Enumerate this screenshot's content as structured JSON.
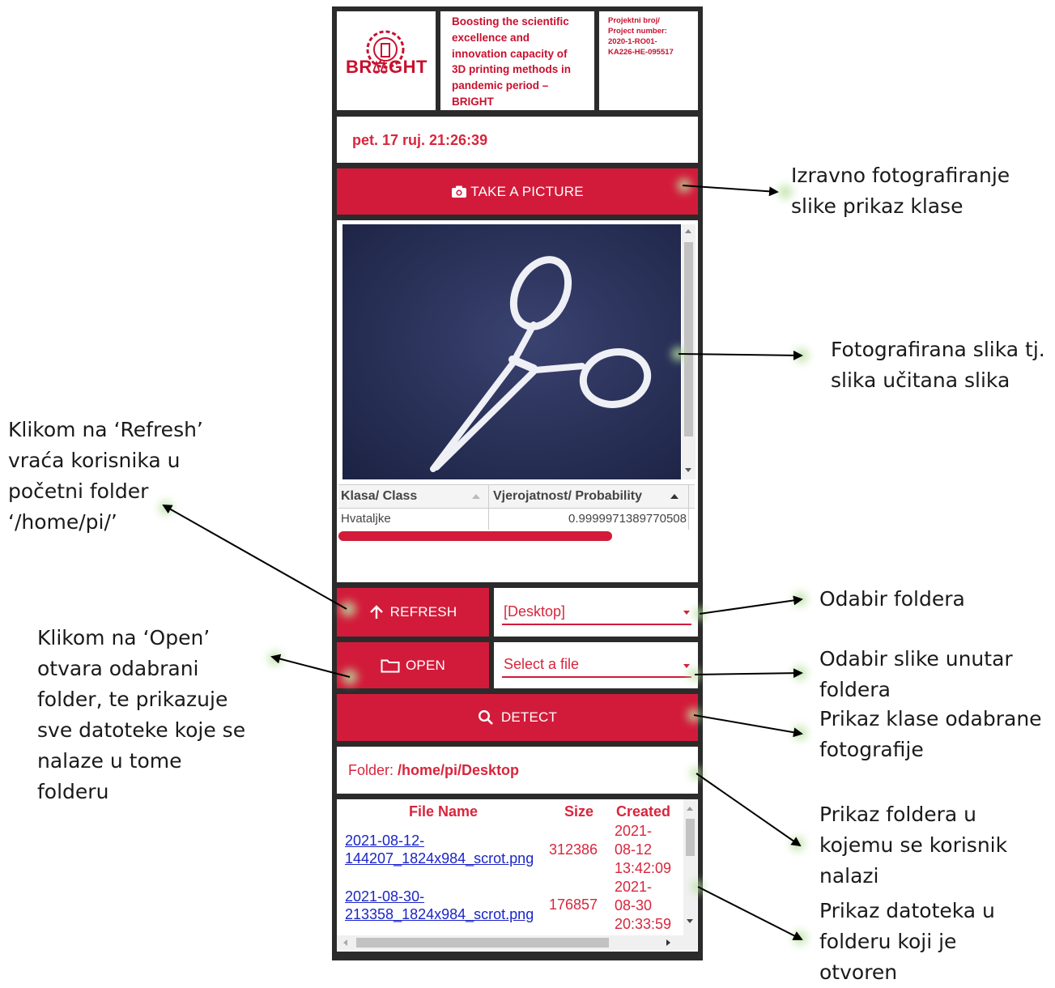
{
  "header": {
    "logo_text": "BR⚖GHT",
    "project_title_lines": [
      "Boosting the scientific",
      "excellence and",
      "innovation capacity of",
      "3D printing methods in",
      "pandemic period –",
      "BRIGHT"
    ],
    "project_number_lines": [
      "Projektni broj/",
      "Project number:",
      "2020-1-RO01-",
      "KA226-HE-095517"
    ]
  },
  "datetime": "pet. 17 ruj. 21:26:39",
  "buttons": {
    "take_picture": "TAKE A PICTURE",
    "refresh": "REFRESH",
    "open": "OPEN",
    "detect": "DETECT"
  },
  "results_table": {
    "columns": [
      "Klasa/ Class",
      "Vjerojatnost/ Probability"
    ],
    "rows": [
      {
        "class": "Hvataljke",
        "probability": "0.9999971389770508",
        "probability_fraction": 0.9999971389770508
      }
    ]
  },
  "folder_select": {
    "value": "[Desktop]"
  },
  "file_select": {
    "placeholder": "Select a file"
  },
  "folder_path": {
    "label": "Folder: ",
    "value": "/home/pi/Desktop"
  },
  "file_table": {
    "columns": [
      "File Name",
      "Size",
      "Created"
    ],
    "rows": [
      {
        "name_line1": "2021-08-12-",
        "name_line2": "144207_1824x984_scrot.png",
        "size": "312386",
        "created_lines": [
          "2021-",
          "08-12",
          "13:42:09"
        ]
      },
      {
        "name_line1": "2021-08-30-",
        "name_line2": "213358_1824x984_scrot.png",
        "size": "176857",
        "created_lines": [
          "2021-",
          "08-30",
          "20:33:59"
        ]
      }
    ]
  },
  "annotations": {
    "take_picture": [
      "Izravno fotografiranje",
      "slike prikaz klase"
    ],
    "image": [
      "Fotografirana slika tj.",
      "slika učitana slika"
    ],
    "refresh": [
      "Klikom na ‘Refresh’",
      "vraća korisnika u",
      "početni folder",
      "‘/home/pi/’"
    ],
    "folder_select": [
      "Odabir foldera"
    ],
    "open": [
      "Klikom na ‘Open’",
      "otvara odabrani",
      "folder, te prikazuje",
      "sve datoteke koje se",
      "nalaze u tome",
      "folderu"
    ],
    "file_select": [
      "Odabir slike unutar",
      "foldera"
    ],
    "detect": [
      "Prikaz klase odabrane",
      "fotografije"
    ],
    "folder_path": [
      "Prikaz foldera u",
      "kojemu se korisnik",
      "nalazi"
    ],
    "file_list": [
      "Prikaz datoteka u",
      "folderu koji je",
      "otvoren"
    ]
  },
  "colors": {
    "accent": "#d21b3a",
    "panel_border": "#2b2b2b",
    "link": "#1a25c8"
  },
  "icons": {
    "take_picture": "camera-icon",
    "refresh": "arrow-up-icon",
    "open": "folder-icon",
    "detect": "search-icon"
  }
}
